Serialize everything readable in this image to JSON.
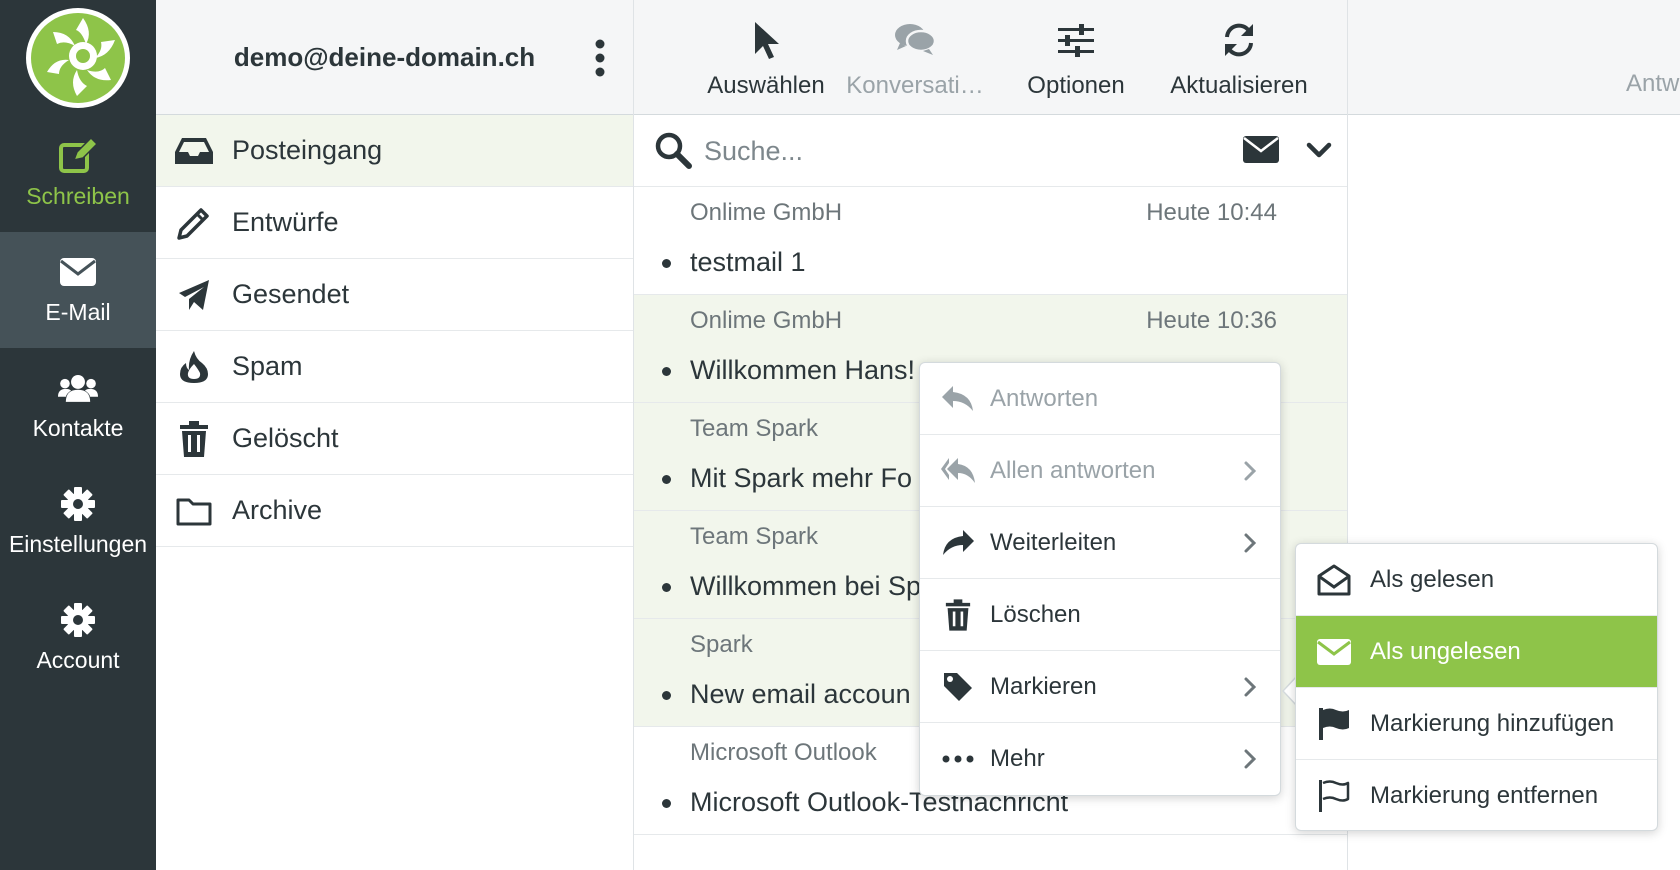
{
  "colors": {
    "rail_bg": "#2c363a",
    "rail_active": "#455258",
    "accent": "#8ec449",
    "highlight_row": "#f2f6ec"
  },
  "nav": {
    "compose": {
      "label": "Schreiben",
      "icon": "compose-icon"
    },
    "mail": {
      "label": "E-Mail",
      "icon": "envelope-icon"
    },
    "contacts": {
      "label": "Kontakte",
      "icon": "users-icon"
    },
    "settings": {
      "label": "Einstellungen",
      "icon": "gear-icon"
    },
    "account": {
      "label": "Account",
      "icon": "gear-icon"
    }
  },
  "account": {
    "email": "demo@deine-domain.ch"
  },
  "folders": [
    {
      "label": "Posteingang",
      "icon": "inbox-icon"
    },
    {
      "label": "Entwürfe",
      "icon": "pencil-icon"
    },
    {
      "label": "Gesendet",
      "icon": "paper-plane-icon"
    },
    {
      "label": "Spam",
      "icon": "fire-icon"
    },
    {
      "label": "Gelöscht",
      "icon": "trash-icon"
    },
    {
      "label": "Archive",
      "icon": "folder-icon"
    }
  ],
  "toolbar": {
    "select": "Auswählen",
    "conversations": "Konversati…",
    "options": "Optionen",
    "refresh": "Aktualisieren"
  },
  "search": {
    "placeholder": "Suche..."
  },
  "messages": [
    {
      "sender": "Onlime GmbH",
      "time": "Heute 10:44",
      "subject": "testmail 1"
    },
    {
      "sender": "Onlime GmbH",
      "time": "Heute 10:36",
      "subject": "Willkommen Hans!"
    },
    {
      "sender": "Team Spark",
      "time": "",
      "subject": "Mit Spark mehr Fo"
    },
    {
      "sender": "Team Spark",
      "time": "",
      "subject": "Willkommen bei Sp"
    },
    {
      "sender": "Spark",
      "time": "",
      "subject": "New email accoun"
    },
    {
      "sender": "Microsoft Outlook",
      "time": "",
      "subject": "Microsoft Outlook-Testnachricht"
    }
  ],
  "preview": {
    "reply_label": "Antw"
  },
  "context_menu": {
    "reply": "Antworten",
    "reply_all": "Allen antworten",
    "forward": "Weiterleiten",
    "delete": "Löschen",
    "mark": "Markieren",
    "more": "Mehr"
  },
  "mark_submenu": {
    "as_read": "Als gelesen",
    "as_unread": "Als ungelesen",
    "add_flag": "Markierung hinzufügen",
    "remove_flag": "Markierung entfernen"
  }
}
